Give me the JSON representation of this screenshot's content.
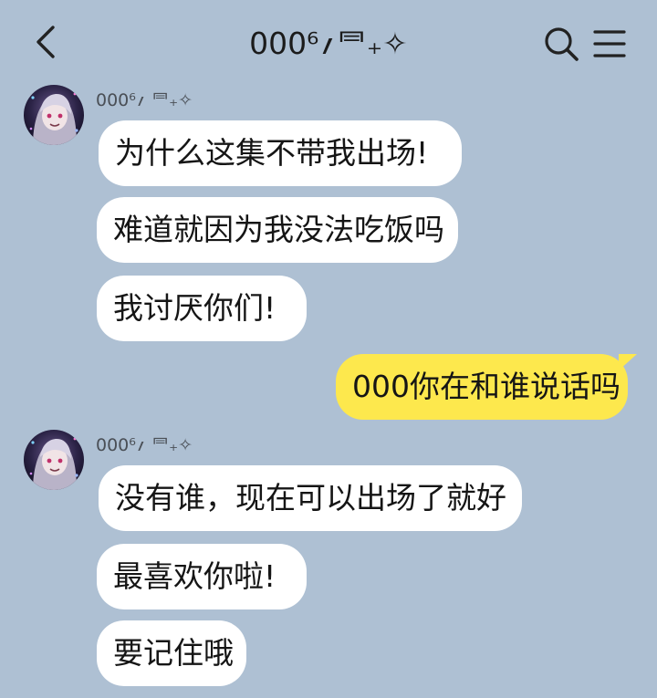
{
  "header": {
    "title": "000⁶؍⺜₊✧",
    "back_icon": "chevron-left-icon",
    "search_icon": "search-icon",
    "menu_icon": "hamburger-menu-icon"
  },
  "contact": {
    "name": "000⁶؍⺜₊✧"
  },
  "groups": [
    {
      "sender": "000⁶؍ ⺜₊✧",
      "messages": [
        "为什么这集不带我出场!",
        "难道就因为我没法吃饭吗",
        "我讨厌你们!"
      ]
    },
    {
      "sender": "self",
      "messages": [
        "000你在和谁说话吗"
      ]
    },
    {
      "sender": "000⁶؍ ⺜₊✧",
      "messages": [
        "没有谁，现在可以出场了就好",
        "最喜欢你啦!",
        "要记住哦"
      ]
    }
  ],
  "colors": {
    "background": "#aec0d3",
    "incoming_bubble": "#ffffff",
    "outgoing_bubble": "#fde84d"
  }
}
